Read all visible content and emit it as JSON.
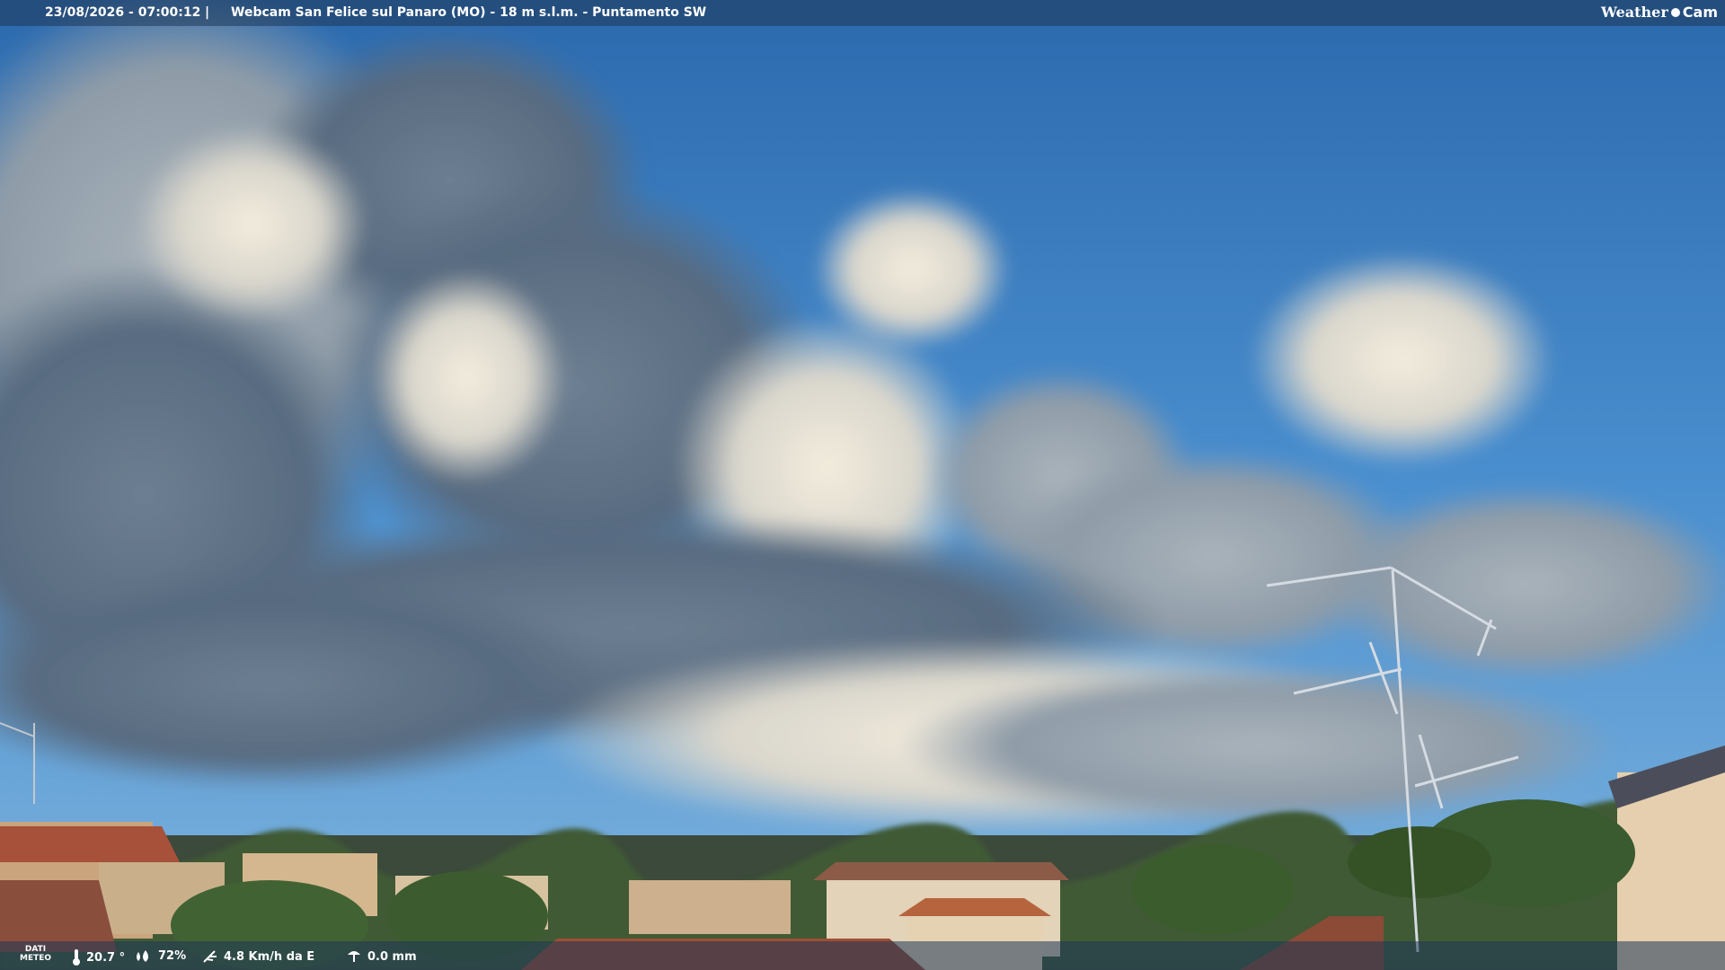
{
  "header": {
    "timestamp": "23/08/2026 - 07:00:12",
    "separator": "|",
    "title": "Webcam San Felice sul Panaro (MO) - 18 m s.l.m. - Puntamento SW",
    "brand_left": "Weather",
    "brand_right": "Cam"
  },
  "footer": {
    "meteo_label_line1": "DATI",
    "meteo_label_line2": "METEO",
    "temperature": "20.7 °",
    "humidity": "72%",
    "wind": "4.8 Km/h da E",
    "rain": "0.0 mm"
  },
  "icons": [
    "thermometer-icon",
    "humidity-drop-icon",
    "wind-icon",
    "rain-icon",
    "weathercam-logo-icon"
  ],
  "colors": {
    "sky_top": "#2f6fb3",
    "sky_horizon": "#5aa0d6",
    "bar": "#1e3755"
  }
}
